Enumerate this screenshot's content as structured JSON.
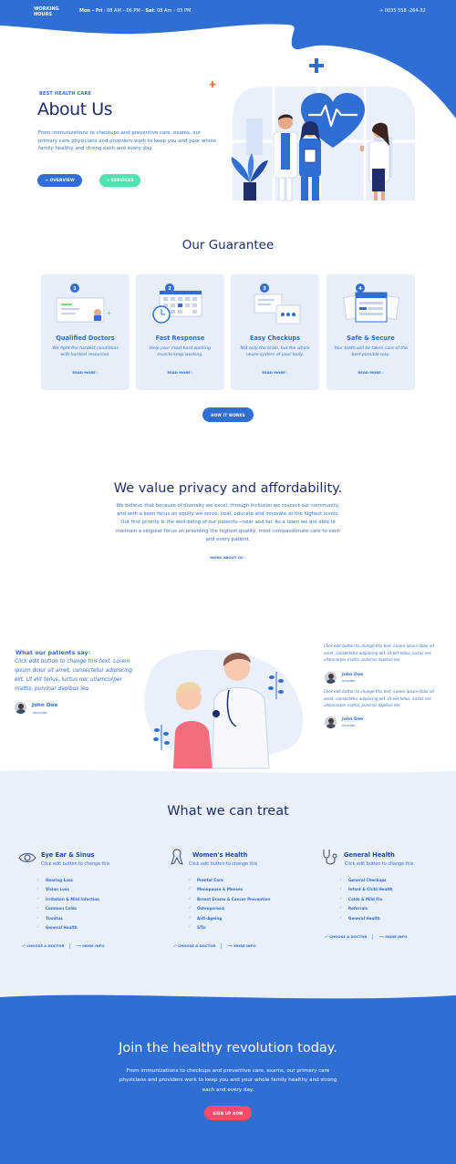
{
  "topbar": {
    "working_hours": "WORKING HOURS",
    "days1": "Mon – Fri",
    "time1": " : 08 AM – 06 PM – ",
    "days2": "Sat",
    "time2": ": 08 Am – 03 PM",
    "phone": "+ 0035 558 -264-32",
    "color": "#2f6ed3"
  },
  "hero": {
    "eyebrow": "BEST HEALTH CARE",
    "title": "About Us",
    "text": "From immunizations to checkups and  preventive care,  exams, our primary care physicians and providers work to keep you and your whole family healthy and strong each and every day.",
    "btn_overview": "→ OVERVIEW",
    "btn_services": "→ SERVICES"
  },
  "guarantee": {
    "title": "Our Guarantee",
    "cards": [
      {
        "num": "1",
        "title": "Qualified Doctors",
        "text": "We fight the hardest conditions with hardest resources.",
        "more": "READ MORE ›"
      },
      {
        "num": "2",
        "title": "Fast Response",
        "text": "Help your most hard working muscle keep working.",
        "more": "READ MORE ›"
      },
      {
        "num": "3",
        "title": "Easy Checkups",
        "text": "Not only the brain, but the whole neuro-system of your body.",
        "more": "READ MORE ›"
      },
      {
        "num": "4",
        "title": "Safe & Secure",
        "text": "Your teeth will be taken care of the best possible way.",
        "more": "READ MORE ›"
      }
    ],
    "button": "HOW IT WORKS"
  },
  "privacy": {
    "title": "We value privacy and affordability.",
    "text": "We believe that because of diversity we excel, through inclusion we respect our community, and with a keen focus on equity we serve, heal, educate and innovate at the highest levels. Our first priority is the well-being of our patients—near and far. As a team we are able to maintain a singular focus on providing the highest quality, most compassionate care to each and every patient.",
    "more": "MORE ABOUT US ›"
  },
  "testimonials": {
    "heading": "What our patients say:",
    "quote": "Click edit button to change this text. Lorem ipsum dolor sit amet, consectetur adipiscing elit. Ut elit tellus, luctus nec ullamcorper mattis, pulvinar dapibus leo.",
    "name": "John Doe",
    "role": "DESIGNER",
    "side": [
      {
        "quote": "Click edit button to change this text. Lorem ipsum dolor sit amet, consectetur adipiscing elit. Ut elit tellus, luctus nec ullamcorper mattis, pulvinar dapibus leo.",
        "name": "John Doe",
        "role": "DESIGNER"
      },
      {
        "quote": "Click edit button to change this text. Lorem ipsum dolor sit amet, consectetur adipiscing elit. Ut elit tellus, luctus nec ullamcorper mattis, pulvinar dapibus leo.",
        "name": "John Doe",
        "role": "DESIGNER"
      }
    ]
  },
  "treat": {
    "title": "What we can treat",
    "columns": [
      {
        "icon": "eye-icon",
        "title": "Eye Ear & Sinus",
        "sub": "Click edit button to change this",
        "items": [
          "Hearing Loss",
          "Vision Loss",
          "Irritation & Mild Infection",
          "Common Colds",
          "Tinnitus",
          "General Health"
        ],
        "choose": "CHOOSE A DOCTOR",
        "more": "MORE INFO"
      },
      {
        "icon": "ribbon-icon",
        "title": "Women's Health",
        "sub": "Click edit button to change this",
        "items": [
          "Prental Care",
          "Menopause & Menses",
          "Breast Exams & Cancer Prevention",
          "Osteoporosis",
          "Anti-Ageing",
          "STIs"
        ],
        "choose": "CHOOSE A DOCTOR",
        "more": "MORE INFO"
      },
      {
        "icon": "stethoscope-icon",
        "title": "General Health",
        "sub": "Click edit button to change this",
        "items": [
          "General Checkups",
          "Infant & Child Health",
          "Colds & Mild Flu",
          "Referrals",
          "General Health"
        ],
        "choose": "CHOOSE A DOCTOR",
        "more": "MORE INFO"
      }
    ]
  },
  "join": {
    "title": "Join the healthy revolution today.",
    "text": "From immunizations to checkups and  preventive care,  exams, our primary care physicians and providers work to keep you and your whole family healthy and strong each and every day.",
    "button": "SIGN UP NOW",
    "accent": "#ff4b6a"
  }
}
